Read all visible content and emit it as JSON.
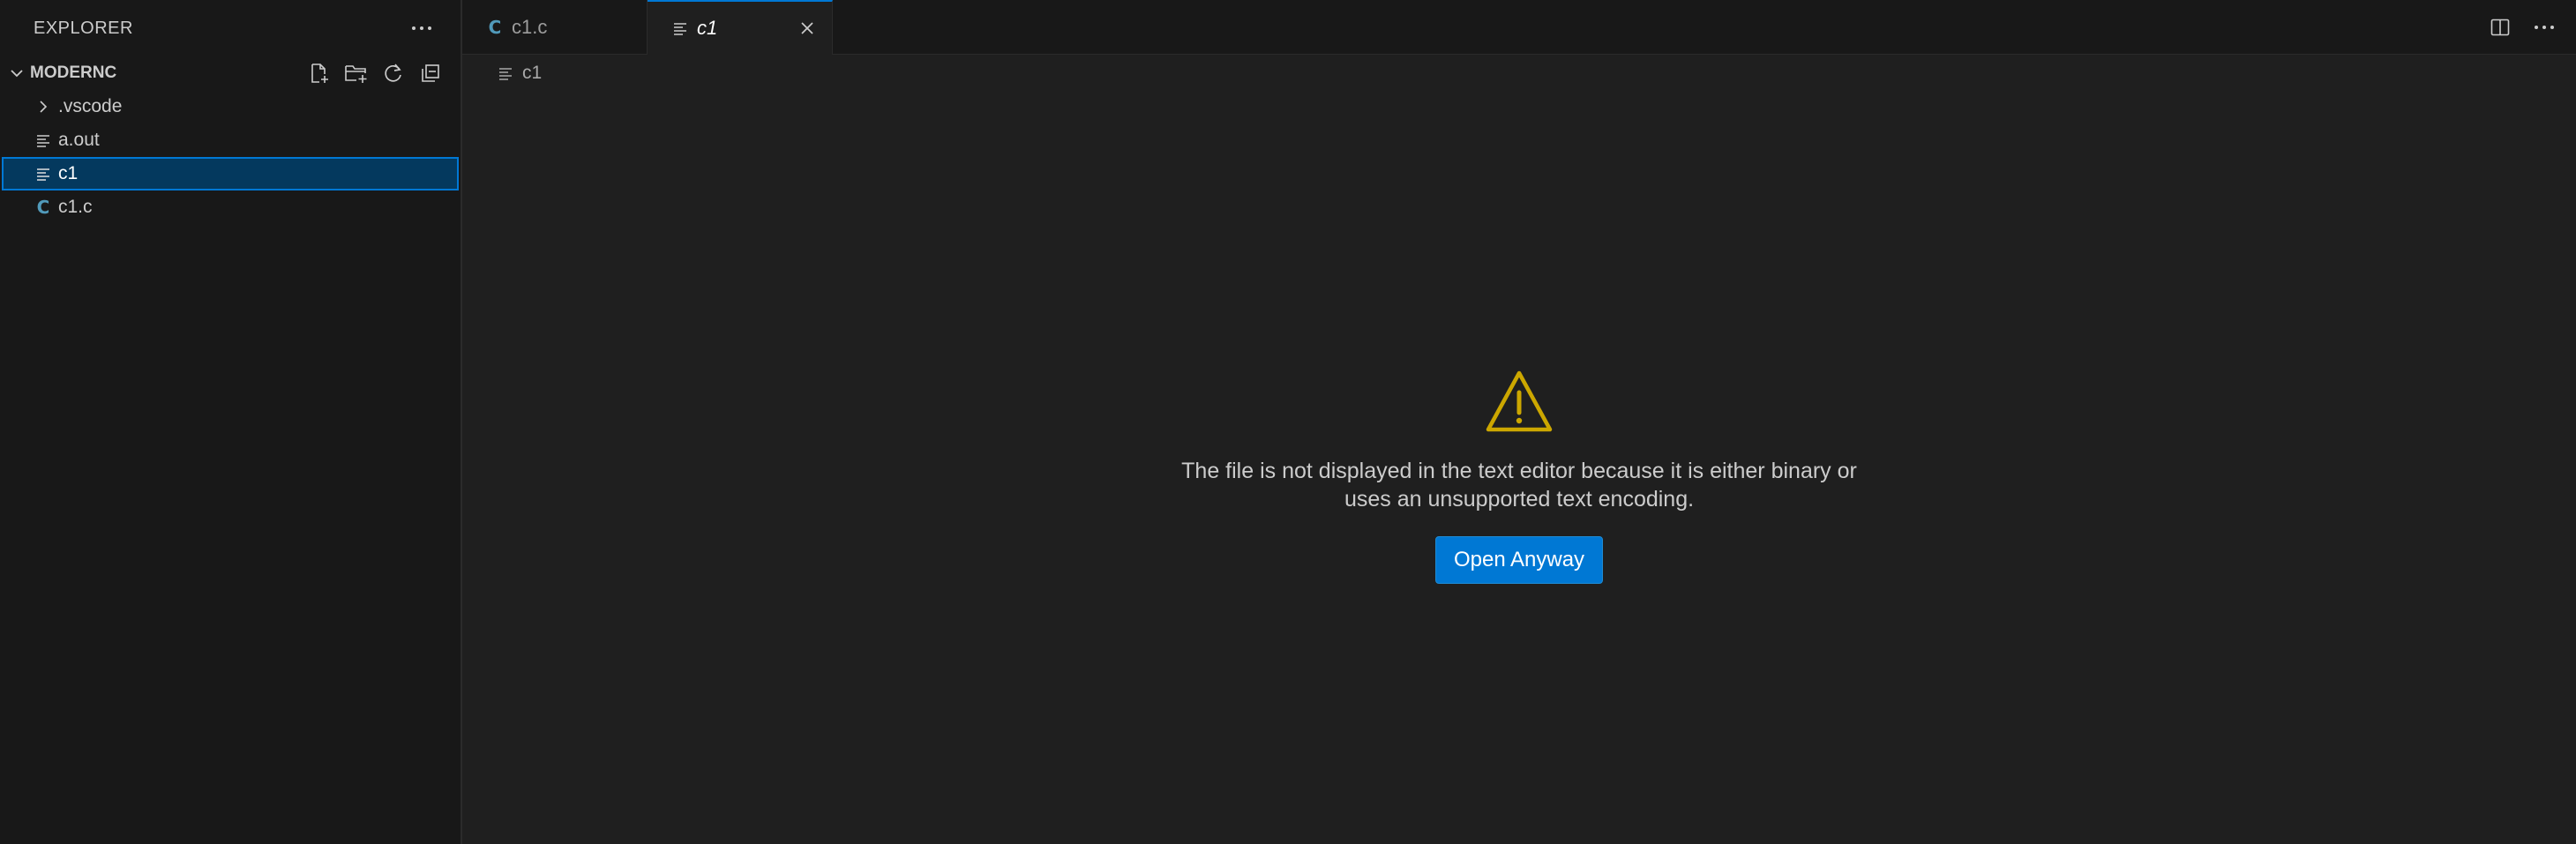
{
  "sidebar": {
    "title": "EXPLORER",
    "section": {
      "title": "MODERNC",
      "actions": [
        {
          "name": "new-file",
          "icon": "new-file-icon"
        },
        {
          "name": "new-folder",
          "icon": "new-folder-icon"
        },
        {
          "name": "refresh",
          "icon": "refresh-icon"
        },
        {
          "name": "collapse-all",
          "icon": "collapse-all-icon"
        }
      ]
    },
    "items": [
      {
        "label": ".vscode",
        "icon": "chevron-right-icon",
        "type": "folder"
      },
      {
        "label": "a.out",
        "icon": "text-file-icon",
        "type": "file"
      },
      {
        "label": "c1",
        "icon": "text-file-icon",
        "type": "file",
        "selected": true
      },
      {
        "label": "c1.c",
        "icon": "c-file-icon",
        "type": "file"
      }
    ]
  },
  "tabs": [
    {
      "label": "c1.c",
      "icon": "c-file-icon",
      "active": false
    },
    {
      "label": "c1",
      "icon": "text-file-icon",
      "active": true
    }
  ],
  "breadcrumb": {
    "items": [
      "c1"
    ]
  },
  "notice": {
    "message": "The file is not displayed in the text editor because it is either binary or uses an unsupported text encoding.",
    "button_label": "Open Anyway"
  },
  "colors": {
    "accent": "#0078d4",
    "selection": "#04395e",
    "warning": "#cca700",
    "c_icon": "#519aba"
  }
}
